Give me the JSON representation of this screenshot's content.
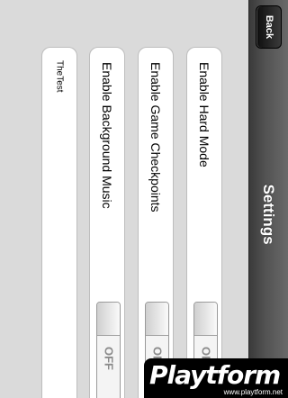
{
  "navbar": {
    "title": "Settings",
    "back_label": "Back"
  },
  "settings": [
    {
      "label": "Enable Hard Mode",
      "state": "OFF"
    },
    {
      "label": "Enable Game Checkpoints",
      "state": "OFF"
    },
    {
      "label": "Enable Background Music",
      "state": "OFF"
    }
  ],
  "text_item": {
    "label": "TheTest"
  },
  "watermark": {
    "brand": "Playtform",
    "url": "www.playtform.net"
  },
  "colors": {
    "navbar": "#4a4a4a",
    "background": "#dadada",
    "cell": "#ffffff"
  }
}
